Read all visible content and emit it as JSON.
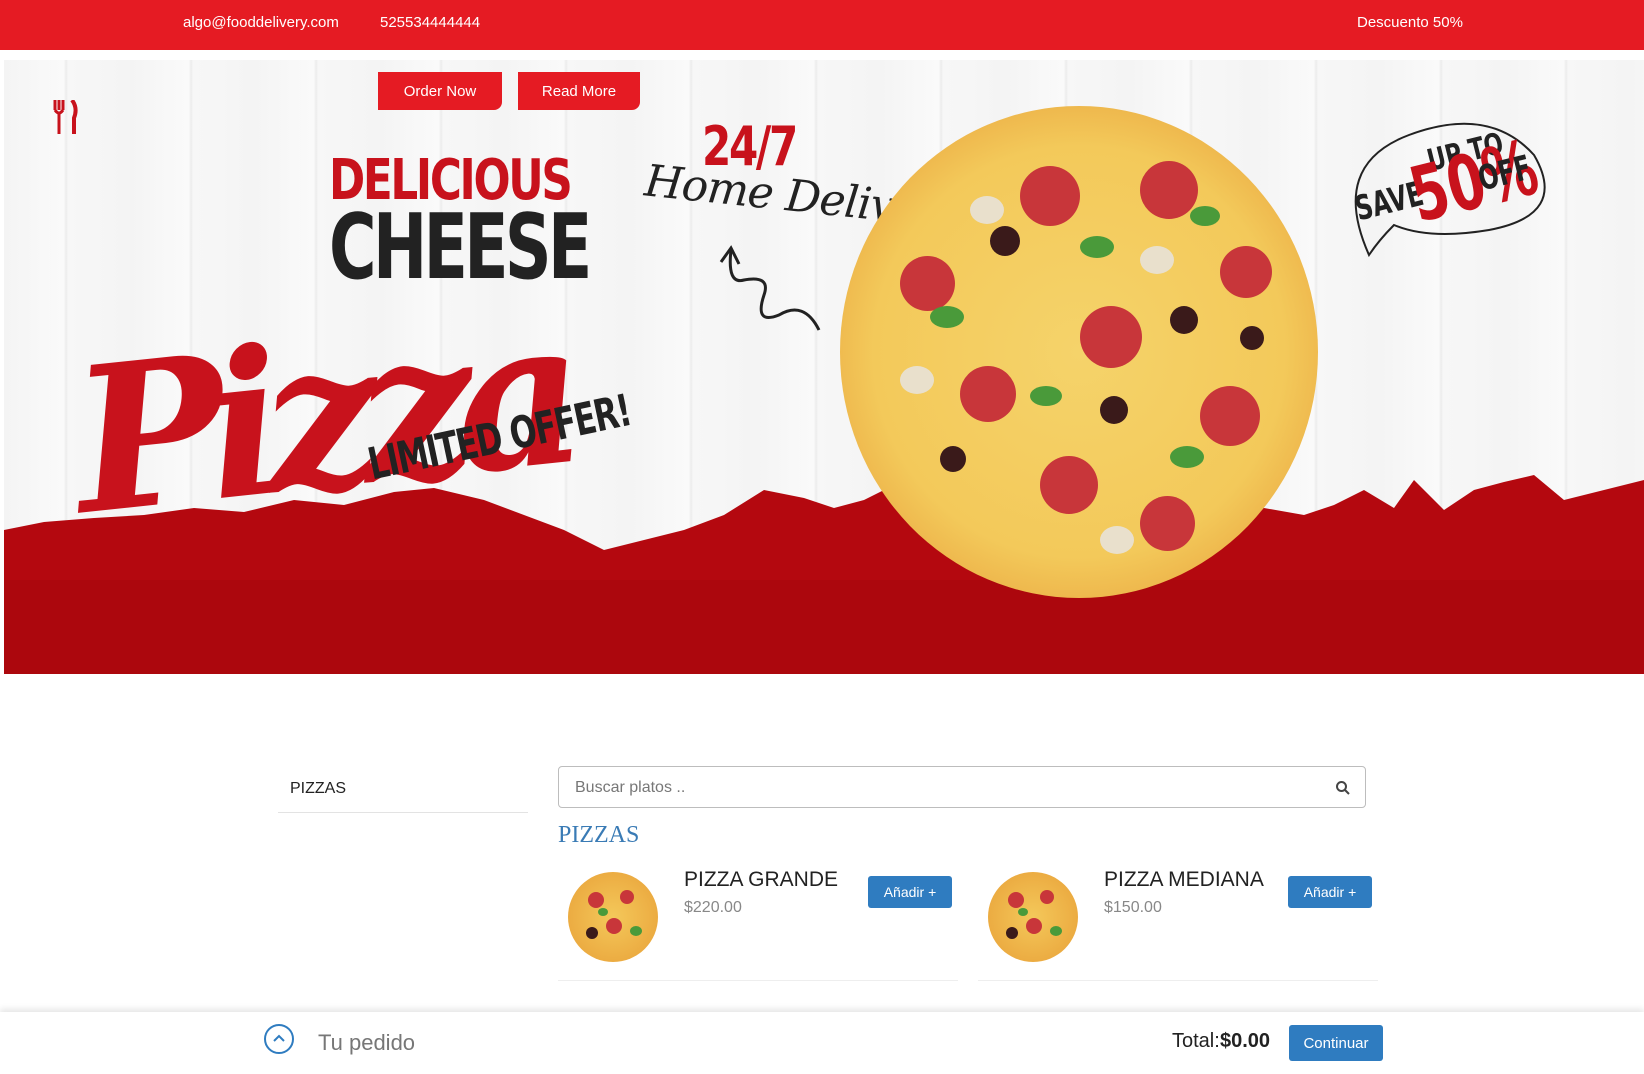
{
  "topbar": {
    "email": "algo@fooddelivery.com",
    "phone": "525534444444",
    "promo": "Descuento 50%"
  },
  "hero": {
    "order_now": "Order Now",
    "read_more": "Read More",
    "line_delicious": "DELICIOUS",
    "line_cheese": "CHEESE",
    "line_pizza": "Pizza",
    "line_limited": "LIMITED OFFER!",
    "line_247": "24/7",
    "line_home": "Home Delivery",
    "save_up_to": "UP TO",
    "save_save": "SAVE",
    "save_50": "50%",
    "save_off": "OFF"
  },
  "sidebar": {
    "category": "PIZZAS"
  },
  "search": {
    "placeholder": "Buscar platos .."
  },
  "catalog": {
    "category_title": "PIZZAS",
    "products": [
      {
        "name": "PIZZA GRANDE",
        "price": "$220.00",
        "add_label": "Añadir +"
      },
      {
        "name": "PIZZA MEDIANA",
        "price": "$150.00",
        "add_label": "Añadir +"
      }
    ]
  },
  "cart": {
    "label": "Tu pedido",
    "total_label": "Total:",
    "total_value": "$0.00",
    "continue_label": "Continuar"
  },
  "colors": {
    "brand_red": "#e51b23",
    "accent_blue": "#2f7cc0"
  }
}
